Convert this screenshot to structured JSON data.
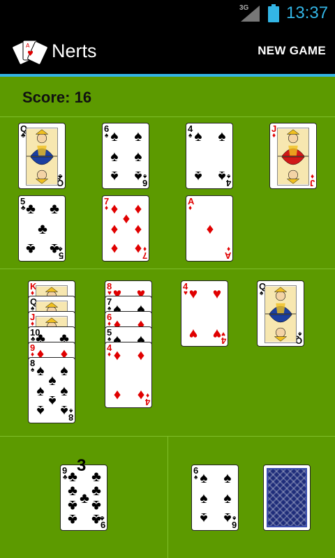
{
  "status": {
    "network": "3G",
    "time": "13:37"
  },
  "app": {
    "title": "Nerts",
    "new_game_label": "NEW GAME"
  },
  "score": {
    "label": "Score: 16"
  },
  "foundations": [
    {
      "rank": "Q",
      "suit": "♣",
      "color": "black",
      "face": true
    },
    {
      "rank": "6",
      "suit": "♠",
      "color": "black",
      "face": false
    },
    {
      "rank": "4",
      "suit": "♠",
      "color": "black",
      "face": false
    },
    {
      "rank": "J",
      "suit": "♦",
      "color": "red",
      "face": true
    },
    {
      "rank": "5",
      "suit": "♣",
      "color": "black",
      "face": false
    },
    {
      "rank": "7",
      "suit": "♦",
      "color": "red",
      "face": false
    },
    {
      "rank": "A",
      "suit": "♦",
      "color": "red",
      "face": false
    }
  ],
  "tableau": [
    {
      "cards": [
        {
          "rank": "K",
          "suit": "♦",
          "color": "red"
        },
        {
          "rank": "Q",
          "suit": "♠",
          "color": "black"
        },
        {
          "rank": "J",
          "suit": "♦",
          "color": "red"
        },
        {
          "rank": "10",
          "suit": "♣",
          "color": "black"
        },
        {
          "rank": "9",
          "suit": "♦",
          "color": "red"
        },
        {
          "rank": "8",
          "suit": "♠",
          "color": "black"
        }
      ]
    },
    {
      "cards": [
        {
          "rank": "8",
          "suit": "♥",
          "color": "red"
        },
        {
          "rank": "7",
          "suit": "♠",
          "color": "black"
        },
        {
          "rank": "6",
          "suit": "♦",
          "color": "red"
        },
        {
          "rank": "5",
          "suit": "♠",
          "color": "black"
        },
        {
          "rank": "4",
          "suit": "♦",
          "color": "red"
        }
      ]
    },
    {
      "cards": [
        {
          "rank": "4",
          "suit": "♥",
          "color": "red"
        }
      ]
    },
    {
      "cards": [
        {
          "rank": "Q",
          "suit": "♠",
          "color": "black"
        }
      ]
    }
  ],
  "nerts_pile": {
    "top": {
      "rank": "9",
      "suit": "♣",
      "color": "black"
    },
    "count": "3"
  },
  "waste": {
    "top": {
      "rank": "6",
      "suit": "♠",
      "color": "black"
    }
  },
  "stock": {
    "icon": "card-back-icon"
  },
  "colors": {
    "table": "#5c9a00",
    "divider": "#7fbf2a",
    "accent": "#33b5e5"
  }
}
